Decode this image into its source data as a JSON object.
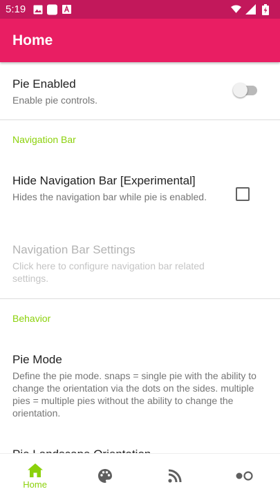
{
  "status_bar": {
    "time": "5:19",
    "icons": [
      "image-icon",
      "square-icon",
      "font-icon",
      "wifi-icon",
      "signal-icon",
      "battery-charging-icon"
    ]
  },
  "app_bar": {
    "title": "Home"
  },
  "colors": {
    "status_bar": "#c2185b",
    "app_bar": "#e91e63",
    "accent": "#8bd10a"
  },
  "prefs": {
    "pie_enabled": {
      "title": "Pie Enabled",
      "summary": "Enable pie controls.",
      "checked": false
    },
    "category_navigation": "Navigation Bar",
    "hide_nav_bar": {
      "title": "Hide Navigation Bar [Experimental]",
      "summary": "Hides the navigation bar while pie is enabled.",
      "checked": false
    },
    "nav_bar_settings": {
      "title": "Navigation Bar Settings",
      "summary": "Click here to configure navigation bar related settings.",
      "enabled": false
    },
    "category_behavior": "Behavior",
    "pie_mode": {
      "title": "Pie Mode",
      "summary": "Define the pie mode. snaps = single pie with the ability to change the orientation via the dots on the sides. multiple pies = multiple pies without the ability to change the orientation."
    },
    "pie_landscape_orientation": {
      "title": "Pie Landscape Orientation"
    }
  },
  "bottom_nav": {
    "items": [
      {
        "icon": "home-icon",
        "label": "Home",
        "active": true
      },
      {
        "icon": "palette-icon",
        "label": "",
        "active": false
      },
      {
        "icon": "rss-icon",
        "label": "",
        "active": false
      },
      {
        "icon": "toggle-dots-icon",
        "label": "",
        "active": false
      }
    ]
  }
}
